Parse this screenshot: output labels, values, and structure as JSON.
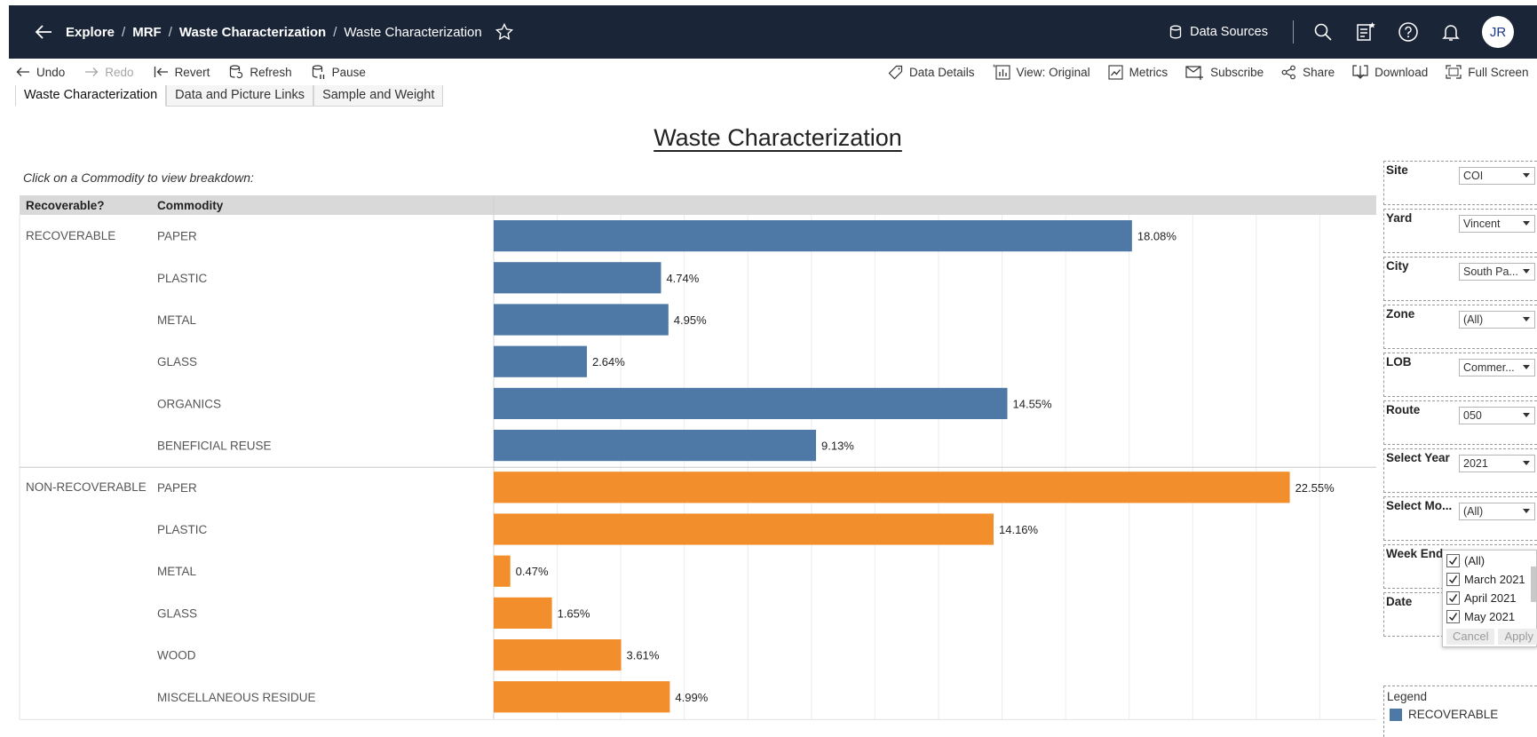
{
  "nav": {
    "breadcrumbs": [
      {
        "label": "Explore",
        "bold": true
      },
      {
        "label": "MRF",
        "bold": true
      },
      {
        "label": "Waste Characterization",
        "bold": true
      },
      {
        "label": "Waste Characterization",
        "bold": false
      }
    ],
    "separator": "/",
    "data_sources": "Data Sources",
    "avatar_initials": "JR"
  },
  "toolbar": {
    "undo": "Undo",
    "redo": "Redo",
    "revert": "Revert",
    "refresh": "Refresh",
    "pause": "Pause",
    "data_details": "Data Details",
    "view": "View: Original",
    "metrics": "Metrics",
    "subscribe": "Subscribe",
    "share": "Share",
    "download": "Download",
    "full_screen": "Full Screen"
  },
  "tabs": [
    {
      "label": "Waste Characterization",
      "active": true
    },
    {
      "label": "Data and Picture Links",
      "active": false
    },
    {
      "label": "Sample and Weight",
      "active": false
    }
  ],
  "dashboard": {
    "title": "Waste Characterization",
    "hint": "Click on a Commodity to view breakdown:"
  },
  "colors": {
    "recoverable": "#4e79a7",
    "non_recoverable": "#f28e2b",
    "nav_bg": "#1b2538"
  },
  "chart_data": {
    "type": "bar",
    "orientation": "horizontal",
    "columns": [
      "Recoverable?",
      "Commodity"
    ],
    "xlim": [
      0,
      25
    ],
    "grid": true,
    "groups": [
      {
        "name": "RECOVERABLE",
        "color": "#4e79a7",
        "rows": [
          {
            "commodity": "PAPER",
            "value": 18.08,
            "label": "18.08%"
          },
          {
            "commodity": "PLASTIC",
            "value": 4.74,
            "label": "4.74%"
          },
          {
            "commodity": "METAL",
            "value": 4.95,
            "label": "4.95%"
          },
          {
            "commodity": "GLASS",
            "value": 2.64,
            "label": "2.64%"
          },
          {
            "commodity": "ORGANICS",
            "value": 14.55,
            "label": "14.55%"
          },
          {
            "commodity": "BENEFICIAL REUSE",
            "value": 9.13,
            "label": "9.13%"
          }
        ]
      },
      {
        "name": "NON-RECOVERABLE",
        "color": "#f28e2b",
        "rows": [
          {
            "commodity": "PAPER",
            "value": 22.55,
            "label": "22.55%"
          },
          {
            "commodity": "PLASTIC",
            "value": 14.16,
            "label": "14.16%"
          },
          {
            "commodity": "METAL",
            "value": 0.47,
            "label": "0.47%"
          },
          {
            "commodity": "GLASS",
            "value": 1.65,
            "label": "1.65%"
          },
          {
            "commodity": "WOOD",
            "value": 3.61,
            "label": "3.61%"
          },
          {
            "commodity": "MISCELLANEOUS RESIDUE",
            "value": 4.99,
            "label": "4.99%"
          }
        ]
      }
    ]
  },
  "filters": [
    {
      "label": "Site",
      "value": "COI"
    },
    {
      "label": "Yard",
      "value": "Vincent"
    },
    {
      "label": "City",
      "value": "South Pa..."
    },
    {
      "label": "Zone",
      "value": "(All)"
    },
    {
      "label": "LOB",
      "value": "Commer..."
    },
    {
      "label": "Route",
      "value": "050"
    },
    {
      "label": "Select Year",
      "value": "2021"
    },
    {
      "label": "Select Mo...",
      "value": "(All)"
    },
    {
      "label": "Week End",
      "value": ""
    },
    {
      "label": "Date",
      "value": ""
    }
  ],
  "month_dropdown": {
    "items": [
      {
        "label": "(All)",
        "checked": true
      },
      {
        "label": "March 2021",
        "checked": true
      },
      {
        "label": "April 2021",
        "checked": true
      },
      {
        "label": "May 2021",
        "checked": true
      }
    ],
    "cancel": "Cancel",
    "apply": "Apply"
  },
  "legend": {
    "title": "Legend",
    "items": [
      {
        "label": "RECOVERABLE",
        "color": "#4e79a7"
      }
    ]
  }
}
